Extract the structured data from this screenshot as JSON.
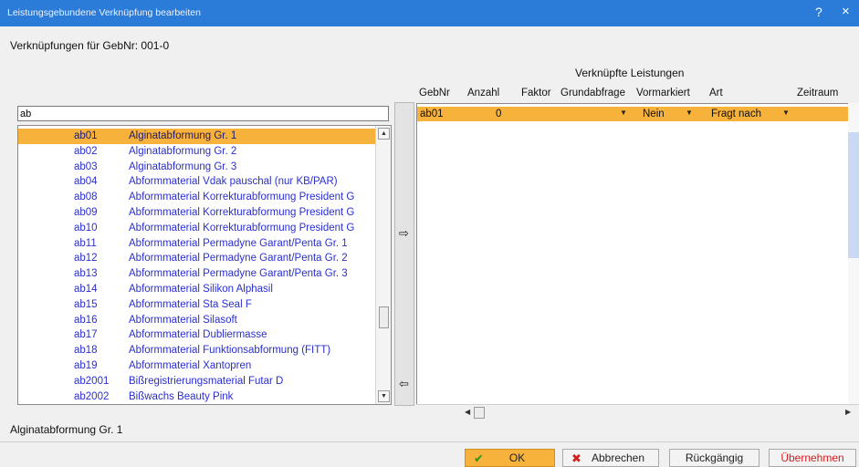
{
  "window": {
    "title": "Leistungsgebundene Verknüpfung bearbeiten",
    "help_label": "?",
    "close_label": "×"
  },
  "subtitle": "Verknüpfungen für GebNr: 001-0",
  "search": {
    "value": "ab"
  },
  "list_items": [
    {
      "code": "ab01",
      "desc": "Alginatabformung Gr. 1",
      "selected": true
    },
    {
      "code": "ab02",
      "desc": "Alginatabformung Gr. 2"
    },
    {
      "code": "ab03",
      "desc": "Alginatabformung Gr. 3"
    },
    {
      "code": "ab04",
      "desc": "Abformmaterial Vdak pauschal (nur KB/PAR)"
    },
    {
      "code": "ab08",
      "desc": "Abformmaterial Korrekturabformung President G"
    },
    {
      "code": "ab09",
      "desc": "Abformmaterial Korrekturabformung President G"
    },
    {
      "code": "ab10",
      "desc": "Abformmaterial Korrekturabformung President G"
    },
    {
      "code": "ab11",
      "desc": "Abformmaterial Permadyne Garant/Penta Gr. 1"
    },
    {
      "code": "ab12",
      "desc": "Abformmaterial Permadyne Garant/Penta Gr. 2"
    },
    {
      "code": "ab13",
      "desc": "Abformmaterial Permadyne Garant/Penta Gr. 3"
    },
    {
      "code": "ab14",
      "desc": "Abformmaterial Silikon Alphasil"
    },
    {
      "code": "ab15",
      "desc": "Abformmaterial Sta Seal F"
    },
    {
      "code": "ab16",
      "desc": "Abformmaterial Silasoft"
    },
    {
      "code": "ab17",
      "desc": "Abformmaterial Dubliermasse"
    },
    {
      "code": "ab18",
      "desc": "Abformmaterial Funktionsabformung (FITT)"
    },
    {
      "code": "ab19",
      "desc": "Abformmaterial Xantopren"
    },
    {
      "code": "ab2001",
      "desc": "Bißregistrierungsmaterial Futar D"
    },
    {
      "code": "ab2002",
      "desc": "Bißwachs Beauty Pink"
    }
  ],
  "grid": {
    "title": "Verknüpfte Leistungen",
    "columns": [
      "GebNr",
      "Anzahl",
      "Faktor",
      "Grundabfrage",
      "Vormarkiert",
      "Art",
      "Zeitraum"
    ],
    "row": {
      "gebnr": "ab01",
      "anzahl": "0",
      "faktor": "",
      "grundabfrage": "",
      "vormarkiert": "Nein",
      "art": "Fragt nach",
      "zeitraum": ""
    }
  },
  "status_text": "Alginatabformung Gr. 1",
  "buttons": {
    "ok": "OK",
    "cancel": "Abbrechen",
    "undo": "Rückgängig",
    "apply": "Übernehmen"
  },
  "colors": {
    "titlebar": "#2b7bd8",
    "highlight": "#f7b23b",
    "list_text": "#2a2ed0",
    "apply_text": "#d11f1f"
  }
}
